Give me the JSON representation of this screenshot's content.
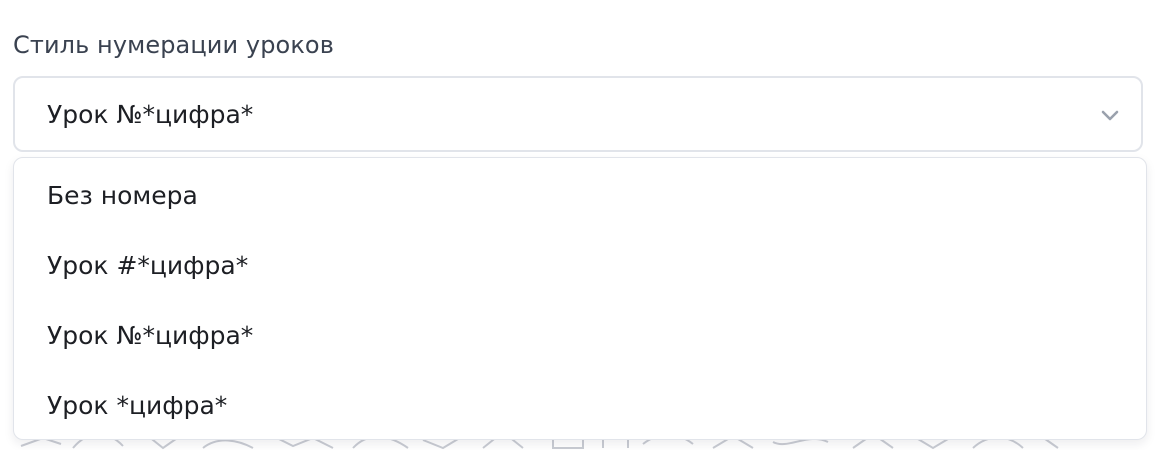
{
  "field": {
    "label": "Стиль нумерации уроков",
    "selected_value": "Урок №*цифра*"
  },
  "icons": {
    "dropdown_toggle": "chevron-down-icon"
  },
  "dropdown": {
    "options": [
      {
        "label": "Без номера"
      },
      {
        "label": "Урок #*цифра*"
      },
      {
        "label": "Урок №*цифра*"
      },
      {
        "label": "Урок *цифра*"
      }
    ]
  },
  "colors": {
    "border": "#e1e4ea",
    "text": "#1d1f24",
    "label_text": "#3a4250",
    "chevron": "#9aa1ad"
  }
}
